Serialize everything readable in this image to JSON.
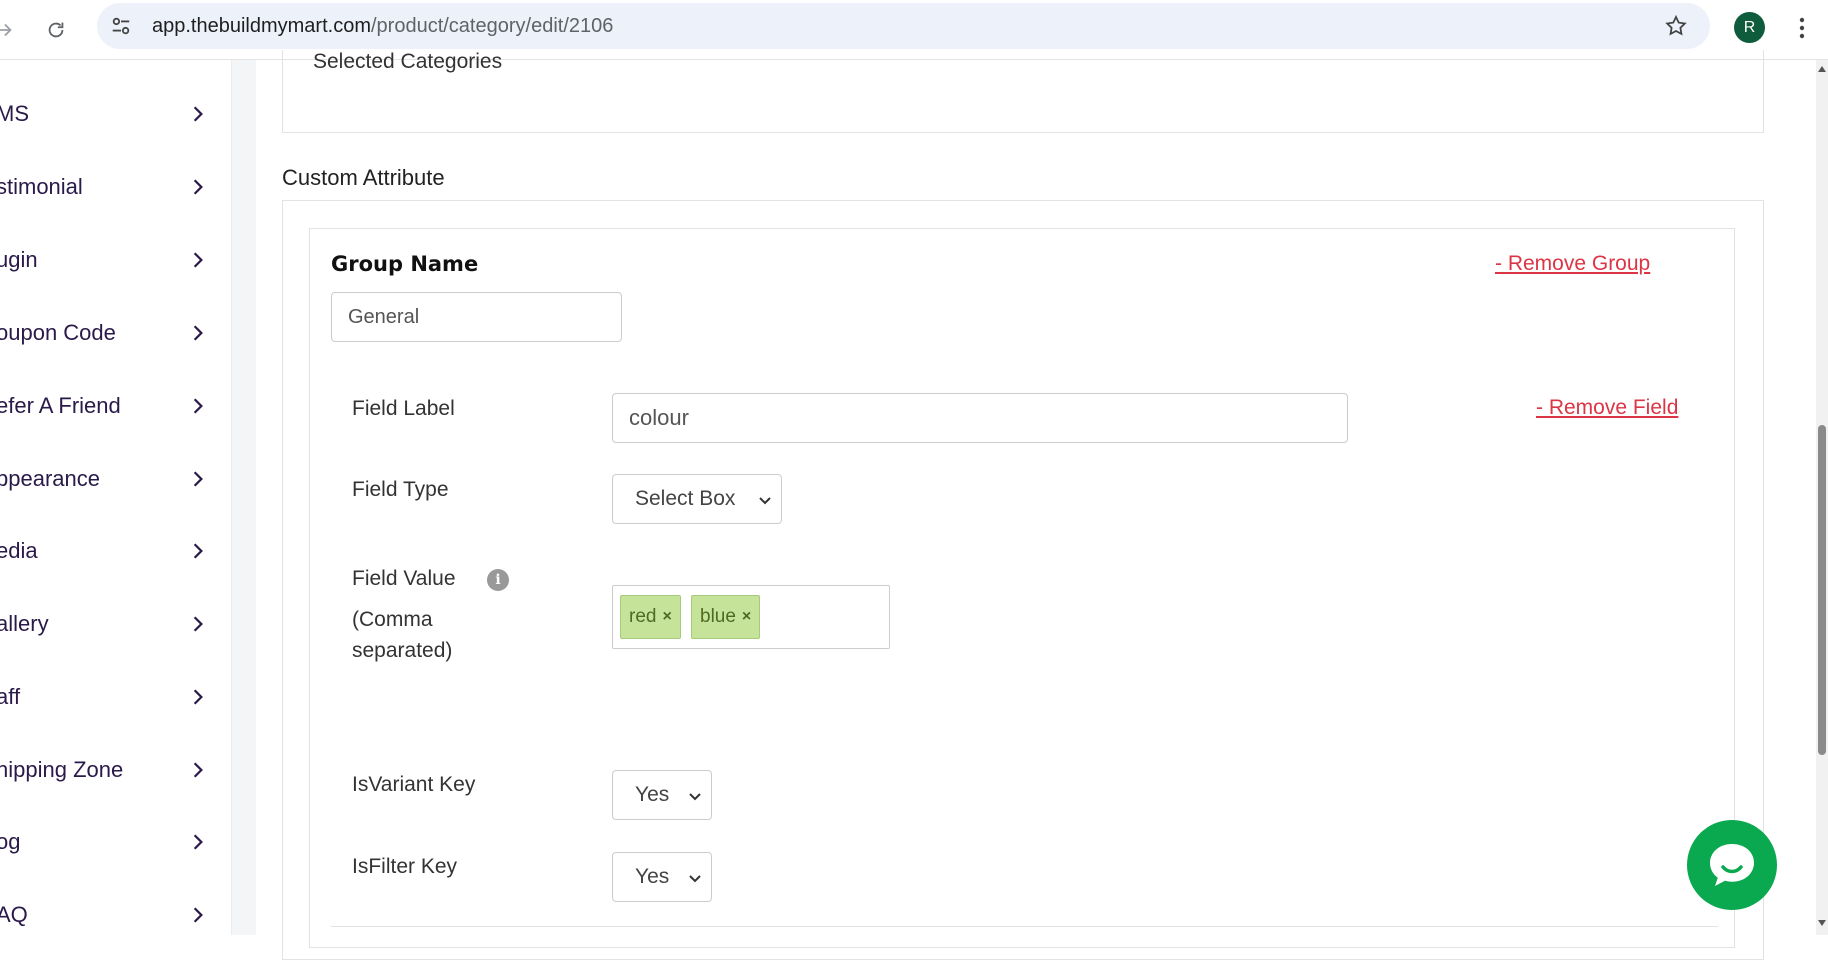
{
  "browser": {
    "url_host": "app.thebuildmymart.com",
    "url_path": "/product/category/edit/2106",
    "profile_initial": "R"
  },
  "sidebar": {
    "items": [
      {
        "label": "MS"
      },
      {
        "label": "stimonial"
      },
      {
        "label": "ugin"
      },
      {
        "label": "oupon Code"
      },
      {
        "label": "efer A Friend"
      },
      {
        "label": "ppearance"
      },
      {
        "label": "edia"
      },
      {
        "label": "allery"
      },
      {
        "label": "aff"
      },
      {
        "label": "hipping Zone"
      },
      {
        "label": "og"
      },
      {
        "label": "AQ"
      }
    ]
  },
  "main": {
    "selected_categories_label": "Selected Categories",
    "section_title": "Custom Attribute",
    "group": {
      "label": "Group Name",
      "value": "General",
      "remove_label": "- Remove Group"
    },
    "field": {
      "label_label": "Field Label",
      "label_value": "colour",
      "remove_label": "- Remove Field",
      "type_label": "Field Type",
      "type_value": "Select Box",
      "value_label_line1": "Field Value",
      "value_label_line2": "(Comma",
      "value_label_line3": "separated)",
      "tags": [
        {
          "text": "red"
        },
        {
          "text": "blue"
        }
      ],
      "variant_label": "IsVariant Key",
      "variant_value": "Yes",
      "filter_label": "IsFilter Key",
      "filter_value": "Yes"
    }
  },
  "colors": {
    "accent_danger": "#dc3545",
    "tag_bg": "#c6e39a",
    "chat_green": "#0aa84f",
    "sidebar_text": "#2a1a4a"
  }
}
